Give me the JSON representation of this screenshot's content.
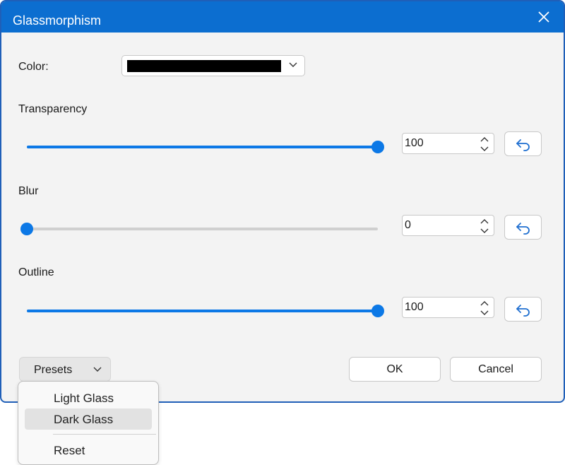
{
  "dialog": {
    "title": "Glassmorphism",
    "close_icon": "close-icon"
  },
  "color": {
    "label": "Color:",
    "value": "#000000"
  },
  "transparency": {
    "label": "Transparency",
    "value": "100",
    "level": 100
  },
  "blur": {
    "label": "Blur",
    "value": "0",
    "level": 0
  },
  "outline": {
    "label": "Outline",
    "value": "100",
    "level": 100
  },
  "footer": {
    "presets_label": "Presets",
    "ok_label": "OK",
    "cancel_label": "Cancel"
  },
  "presets_menu": {
    "items": [
      "Light Glass",
      "Dark Glass",
      "Reset"
    ],
    "highlighted": "Dark Glass"
  },
  "colors": {
    "accent": "#0c78e6",
    "titlebar": "#0c6ed0"
  }
}
